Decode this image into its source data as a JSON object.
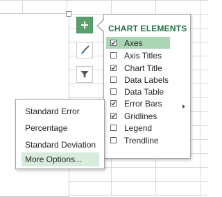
{
  "panel": {
    "title": "CHART ELEMENTS",
    "items": [
      {
        "label": "Axes",
        "checked": true,
        "selected": true,
        "submenu": false
      },
      {
        "label": "Axis Titles",
        "checked": false,
        "selected": false,
        "submenu": false
      },
      {
        "label": "Chart Title",
        "checked": true,
        "selected": false,
        "submenu": false
      },
      {
        "label": "Data Labels",
        "checked": false,
        "selected": false,
        "submenu": false
      },
      {
        "label": "Data Table",
        "checked": false,
        "selected": false,
        "submenu": false
      },
      {
        "label": "Error Bars",
        "checked": true,
        "selected": false,
        "submenu": true
      },
      {
        "label": "Gridlines",
        "checked": true,
        "selected": false,
        "submenu": false
      },
      {
        "label": "Legend",
        "checked": false,
        "selected": false,
        "submenu": false
      },
      {
        "label": "Trendline",
        "checked": false,
        "selected": false,
        "submenu": false
      }
    ]
  },
  "side_buttons": [
    {
      "icon": "plus-icon",
      "active": true
    },
    {
      "icon": "paintbrush-icon",
      "active": false
    },
    {
      "icon": "filter-icon",
      "active": false
    }
  ],
  "flyout": {
    "items": [
      {
        "label": "Standard Error",
        "hover": false
      },
      {
        "label": "Percentage",
        "hover": false
      },
      {
        "label": "Standard Deviation",
        "hover": false
      },
      {
        "label": "More Options...",
        "hover": true
      }
    ]
  },
  "colors": {
    "accent": "#217346",
    "active_button": "#5aa06f",
    "selected_item": "#a9d7b6",
    "hover_item": "#d7ecdd",
    "gridline": "#d9d9d9"
  }
}
